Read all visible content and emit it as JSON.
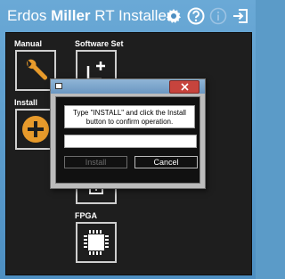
{
  "app": {
    "title_prefix": "Erdos ",
    "title_bold": "Miller",
    "title_suffix": " RT Installer"
  },
  "header_icons": [
    "gear-icon",
    "help-icon",
    "info-icon",
    "exit-icon"
  ],
  "tiles": {
    "manual": {
      "label": "Manual",
      "icon": "wrench-icon"
    },
    "install": {
      "label": "Install",
      "icon": "plus-icon"
    },
    "software_set": {
      "label": "Software Set",
      "icon": "new-file-icon"
    },
    "fpga": {
      "label": "FPGA",
      "icon": "chip-icon"
    }
  },
  "dialog": {
    "message": "Type \"INSTALL\" and click the Install button to confirm operation.",
    "input_value": "",
    "install_label": "Install",
    "cancel_label": "Cancel"
  }
}
